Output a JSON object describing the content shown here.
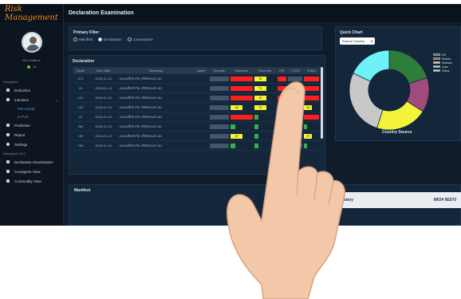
{
  "app": {
    "brand": "Risk Management",
    "page_title": "Declaration Examination"
  },
  "profile": {
    "name": "Mon Hattime",
    "count": "18"
  },
  "sidebar": {
    "section_navigation": "Navigation",
    "items": [
      {
        "label": "Deductive"
      },
      {
        "label": "Inductive"
      },
      {
        "label": "Pre-Arrival"
      },
      {
        "label": "In-Port"
      },
      {
        "label": "Predictive"
      },
      {
        "label": "Report"
      },
      {
        "label": "Settings"
      }
    ],
    "section_nav_old": "Navigation OLD",
    "old_items": [
      {
        "label": "Declaration Examination"
      },
      {
        "label": "Consignee View"
      },
      {
        "label": "Commodity View"
      }
    ]
  },
  "filter": {
    "title": "Primary Filter",
    "options": [
      {
        "label": "Manifest",
        "selected": false
      },
      {
        "label": "Declaration",
        "selected": true
      },
      {
        "label": "Conveyance",
        "selected": false
      }
    ]
  },
  "declaration": {
    "title": "Declaration",
    "columns": [
      "Decl#",
      "Sub. Date",
      "Declarant",
      "Agent",
      "Security",
      "Narcotics",
      "Revenue",
      "IPR",
      "LITES",
      "Public"
    ],
    "rows": [
      {
        "id": "374",
        "date": "2018-01-18",
        "declarant": "เฮงเอเซียจำกัด บริษัทขนส่ง เฮง",
        "cells": [
          [
            "gry",
            ""
          ],
          [
            "red",
            ""
          ],
          [
            "yel",
            "75"
          ],
          [
            "red",
            ""
          ],
          [
            "gry",
            ""
          ],
          [
            "red",
            ""
          ]
        ]
      },
      {
        "id": "23",
        "date": "2018-01-18",
        "declarant": "เฮงเอเซียจำกัด บริษัทขนส่ง เฮง",
        "cells": [
          [
            "gry",
            ""
          ],
          [
            "red",
            ""
          ],
          [
            "yel",
            "73"
          ],
          [
            "red",
            ""
          ],
          [
            "gry",
            ""
          ],
          [
            "red",
            ""
          ]
        ]
      },
      {
        "id": "104",
        "date": "2018-01-18",
        "declarant": "เฮงเอเซียจำกัด บริษัทขนส่ง เฮง",
        "cells": [
          [
            "gry",
            ""
          ],
          [
            "red",
            ""
          ],
          [
            "yel",
            "73"
          ],
          [
            "red",
            ""
          ],
          [
            "gry",
            ""
          ],
          [
            "red",
            ""
          ]
        ]
      },
      {
        "id": "153",
        "date": "2018-01-18",
        "declarant": "เฮงเอเซียจำกัด บริษัทขนส่ง เฮง",
        "cells": [
          [
            "gry",
            ""
          ],
          [
            "yel",
            "34"
          ],
          [
            "yel",
            "73"
          ],
          [
            "yel",
            "58"
          ],
          [
            "gry",
            ""
          ],
          [
            "yel",
            "34"
          ]
        ]
      },
      {
        "id": "22",
        "date": "2018-01-18",
        "declarant": "เฮงเอเซียจำกัด บริษัทขนส่ง เฮง",
        "cells": [
          [
            "gry",
            ""
          ],
          [
            "red",
            ""
          ],
          [
            "grn",
            ""
          ],
          [
            "red",
            ""
          ],
          [
            "gry",
            ""
          ],
          [
            "red",
            ""
          ]
        ]
      },
      {
        "id": "286",
        "date": "2018-01-18",
        "declarant": "เฮงเอเซียจำกัด บริษัทขนส่ง เฮง",
        "cells": [
          [
            "gry",
            ""
          ],
          [
            "grn",
            ""
          ],
          [
            "grn",
            ""
          ],
          [
            "grn",
            ""
          ],
          [
            "gry",
            ""
          ],
          [
            "grn",
            ""
          ]
        ]
      },
      {
        "id": "130",
        "date": "2018-01-18",
        "declarant": "เฮงเอเซียจำกัด บริษัทขนส่ง เฮง",
        "cells": [
          [
            "gry",
            ""
          ],
          [
            "yel",
            "27"
          ],
          [
            "grn",
            ""
          ],
          [
            "yel",
            "27"
          ],
          [
            "gry",
            ""
          ],
          [
            "yel",
            "27"
          ]
        ]
      },
      {
        "id": "296",
        "date": "2018-01-18",
        "declarant": "เฮงเอเซียจำกัด บริษัทขนส่ง เฮง",
        "cells": [
          [
            "gry",
            ""
          ],
          [
            "grn",
            ""
          ],
          [
            "grn",
            ""
          ],
          [
            "grn",
            ""
          ],
          [
            "gry",
            ""
          ],
          [
            "grn",
            ""
          ]
        ]
      }
    ]
  },
  "manifest": {
    "title": "Manifest",
    "history_title": "Fillings & Vessel History",
    "imo": "IMO# 9E570"
  },
  "quick_chart": {
    "title": "Quick Chart",
    "select_value": "Source Country",
    "caption": "Country Source"
  },
  "chart_data": {
    "type": "pie",
    "title": "Country Source",
    "categories": [
      "US",
      "Russia",
      "Vietnam",
      "Laos",
      "China"
    ],
    "values": [
      20,
      14,
      21,
      27,
      18
    ],
    "colors": [
      "#2f7d3a",
      "#a04a7e",
      "#f3f33a",
      "#c8c8c8",
      "#6ef2f8"
    ]
  }
}
